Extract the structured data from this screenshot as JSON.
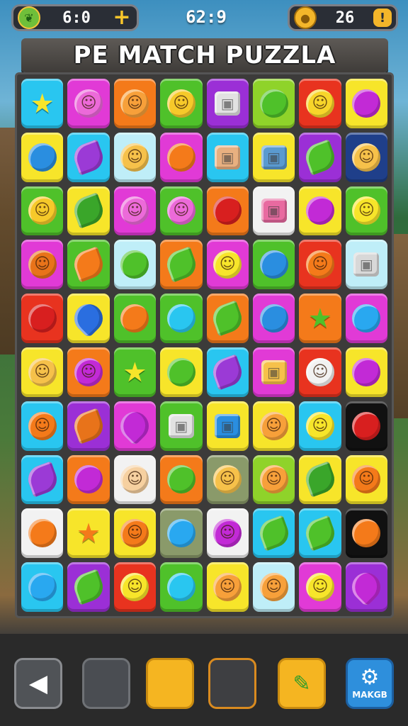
{
  "hud": {
    "gems_icon": "leaf-gem-icon",
    "gems": "6:0",
    "plus": "+",
    "timer": "62:9",
    "coins_icon": "coin-icon",
    "coins": "26",
    "coin_bar": "!"
  },
  "title": "PE MATCH PUZZLA",
  "colors": {
    "cyan": "#29c6f0",
    "magenta": "#e13ad6",
    "orange": "#f47a1a",
    "green": "#4fc12a",
    "purple": "#9b2fd6",
    "lime": "#8fd32a",
    "red": "#e8331f",
    "yellow": "#f7e52a",
    "navy": "#1f3f8a",
    "lightcyan": "#bfeef8",
    "white": "#f2f2f2",
    "sage": "#8a9a6a",
    "black": "#111111"
  },
  "board": {
    "rows": [
      [
        [
          "cyan",
          "star",
          "#f7e52a"
        ],
        [
          "magenta",
          "face",
          "#ec6ad9"
        ],
        [
          "orange",
          "face",
          "#f7a03a"
        ],
        [
          "green",
          "face",
          "#f6c92a"
        ],
        [
          "purple",
          "box",
          "#e2e2e2"
        ],
        [
          "lime",
          "ball",
          "#4fc12a"
        ],
        [
          "red",
          "face",
          "#f7d52a"
        ],
        [
          "yellow",
          "ball",
          "#c22ad6"
        ]
      ],
      [
        [
          "yellow",
          "ball",
          "#2a8ee0"
        ],
        [
          "cyan",
          "leaf",
          "#9b3ad6"
        ],
        [
          "lightcyan",
          "face",
          "#f6c14a"
        ],
        [
          "magenta",
          "ball",
          "#f47a1a"
        ],
        [
          "cyan",
          "box",
          "#e8b080"
        ],
        [
          "yellow",
          "box",
          "#5a9ad0"
        ],
        [
          "purple",
          "leaf",
          "#4fc12a"
        ],
        [
          "navy",
          "face",
          "#f6c14a"
        ]
      ],
      [
        [
          "green",
          "face",
          "#f6c92a"
        ],
        [
          "yellow",
          "leaf",
          "#3aa62a"
        ],
        [
          "magenta",
          "face",
          "#ec6ad9"
        ],
        [
          "green",
          "face",
          "#ec6ad9"
        ],
        [
          "orange",
          "ball",
          "#d81f1f"
        ],
        [
          "white",
          "box",
          "#e86aa0"
        ],
        [
          "yellow",
          "ball",
          "#c22ad6"
        ],
        [
          "green",
          "face",
          "#f7e52a"
        ]
      ],
      [
        [
          "magenta",
          "face",
          "#e8731a"
        ],
        [
          "green",
          "leaf",
          "#f47a1a"
        ],
        [
          "lightcyan",
          "ball",
          "#4fc12a"
        ],
        [
          "orange",
          "leaf",
          "#4fc12a"
        ],
        [
          "magenta",
          "face",
          "#f7e52a"
        ],
        [
          "green",
          "ball",
          "#2a8ee0"
        ],
        [
          "red",
          "face",
          "#f47a1a"
        ],
        [
          "lightcyan",
          "box",
          "#d8d8d8"
        ]
      ],
      [
        [
          "red",
          "ball",
          "#d81f1f"
        ],
        [
          "yellow",
          "drop",
          "#2a6ee0"
        ],
        [
          "green",
          "ball",
          "#f47a1a"
        ],
        [
          "green",
          "ball",
          "#29c6f0"
        ],
        [
          "orange",
          "leaf",
          "#4fc12a"
        ],
        [
          "magenta",
          "ball",
          "#2a8ee0"
        ],
        [
          "orange",
          "star",
          "#4fc12a"
        ],
        [
          "magenta",
          "ball",
          "#29a8f0"
        ]
      ],
      [
        [
          "yellow",
          "face",
          "#f6c14a"
        ],
        [
          "orange",
          "face",
          "#c22ad6"
        ],
        [
          "green",
          "star",
          "#f7e52a"
        ],
        [
          "yellow",
          "ball",
          "#4fc12a"
        ],
        [
          "cyan",
          "leaf",
          "#9b3ad6"
        ],
        [
          "magenta",
          "box",
          "#f6c14a"
        ],
        [
          "red",
          "face",
          "#f2f2f2"
        ],
        [
          "yellow",
          "ball",
          "#c22ad6"
        ]
      ],
      [
        [
          "cyan",
          "face",
          "#f47a1a"
        ],
        [
          "purple",
          "leaf",
          "#e8731a"
        ],
        [
          "magenta",
          "drop",
          "#c22ad6"
        ],
        [
          "green",
          "box",
          "#e2e2e2"
        ],
        [
          "yellow",
          "box",
          "#2a8ee0"
        ],
        [
          "yellow",
          "face",
          "#f7a03a"
        ],
        [
          "cyan",
          "face",
          "#f7e52a"
        ],
        [
          "black",
          "ball",
          "#d81f1f"
        ]
      ],
      [
        [
          "cyan",
          "leaf",
          "#9b3ad6"
        ],
        [
          "orange",
          "ball",
          "#c22ad6"
        ],
        [
          "white",
          "face",
          "#f6d0a0"
        ],
        [
          "orange",
          "ball",
          "#4fc12a"
        ],
        [
          "sage",
          "face",
          "#f6c14a"
        ],
        [
          "lime",
          "face",
          "#f7a03a"
        ],
        [
          "yellow",
          "leaf",
          "#3aa62a"
        ],
        [
          "yellow",
          "face",
          "#f47a1a"
        ]
      ],
      [
        [
          "white",
          "ball",
          "#f47a1a"
        ],
        [
          "yellow",
          "star",
          "#f47a1a"
        ],
        [
          "yellow",
          "face",
          "#f47a1a"
        ],
        [
          "sage",
          "ball",
          "#29a8f0"
        ],
        [
          "white",
          "face",
          "#c22ad6"
        ],
        [
          "cyan",
          "leaf",
          "#4fc12a"
        ],
        [
          "cyan",
          "leaf",
          "#4fc12a"
        ],
        [
          "black",
          "ball",
          "#f47a1a"
        ]
      ],
      [
        [
          "cyan",
          "ball",
          "#29a8f0"
        ],
        [
          "purple",
          "leaf",
          "#4fc12a"
        ],
        [
          "red",
          "face",
          "#f7e52a"
        ],
        [
          "green",
          "ball",
          "#29c6f0"
        ],
        [
          "yellow",
          "face",
          "#f7a03a"
        ],
        [
          "lightcyan",
          "face",
          "#f7a03a"
        ],
        [
          "magenta",
          "face",
          "#f7e52a"
        ],
        [
          "purple",
          "drop",
          "#c22ad6"
        ]
      ]
    ]
  },
  "glyphs": {
    "star": "★",
    "face": "☺",
    "box": "▣",
    "ball": "",
    "leaf": "",
    "drop": ""
  },
  "bottom": {
    "back_icon": "back-arrow-icon",
    "pencil_icon": "pencil-icon",
    "settings_icon": "gear-icon",
    "settings_label": "MAKGB"
  }
}
